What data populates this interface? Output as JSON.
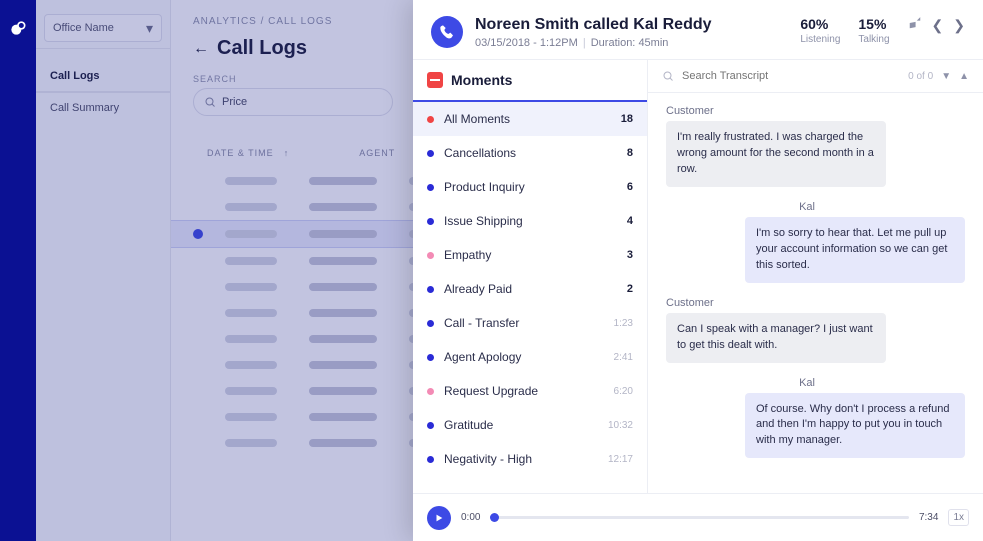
{
  "app": {
    "office": "Office Name"
  },
  "sidebar": {
    "links": [
      "Call Logs",
      "Call Summary"
    ]
  },
  "breadcrumb": "ANALYTICS / CALL LOGS",
  "heading": "Call Logs",
  "search": {
    "label": "SEARCH",
    "value": "Price"
  },
  "table": {
    "columns": [
      "DATE & TIME",
      "AGENT",
      "T"
    ]
  },
  "panel": {
    "title": "Noreen Smith called Kal Reddy",
    "date": "03/15/2018 - 1:12PM",
    "duration_label": "Duration:",
    "duration_value": "45min",
    "metrics": {
      "listening": {
        "value": "60%",
        "label": "Listening"
      },
      "talking": {
        "value": "15%",
        "label": "Talking"
      }
    },
    "moments_heading": "Moments",
    "moments": [
      {
        "label": "All Moments",
        "count": "18",
        "dot": "#f04444",
        "active": true
      },
      {
        "label": "Cancellations",
        "count": "8",
        "dot": "#2a2bd6"
      },
      {
        "label": "Product Inquiry",
        "count": "6",
        "dot": "#2a2bd6"
      },
      {
        "label": "Issue Shipping",
        "count": "4",
        "dot": "#2a2bd6"
      },
      {
        "label": "Empathy",
        "count": "3",
        "dot": "#f38bb5"
      },
      {
        "label": "Already Paid",
        "count": "2",
        "dot": "#2a2bd6"
      },
      {
        "label": "Call - Transfer",
        "time": "1:23",
        "dot": "#2a2bd6"
      },
      {
        "label": "Agent Apology",
        "time": "2:41",
        "dot": "#2a2bd6"
      },
      {
        "label": "Request Upgrade",
        "time": "6:20",
        "dot": "#f38bb5"
      },
      {
        "label": "Gratitude",
        "time": "10:32",
        "dot": "#2a2bd6"
      },
      {
        "label": "Negativity - High",
        "time": "12:17",
        "dot": "#2a2bd6"
      }
    ],
    "transcript_search": {
      "placeholder": "Search Transcript",
      "counter": "0 of 0"
    },
    "transcript": [
      {
        "who": "Customer",
        "side": "left",
        "text": "I'm really frustrated. I was charged the wrong amount for the second month in a row."
      },
      {
        "who": "Kal",
        "side": "right",
        "text": "I'm so sorry to hear that. Let me pull up your account information so we can get this sorted."
      },
      {
        "who": "Customer",
        "side": "left",
        "text": "Can I speak with a manager? I just want to get this dealt with."
      },
      {
        "who": "Kal",
        "side": "right",
        "text": "Of course. Why don't I process a refund and then I'm happy to put you in touch with my manager."
      }
    ],
    "player": {
      "current": "0:00",
      "total": "7:34",
      "speed": "1x"
    }
  }
}
